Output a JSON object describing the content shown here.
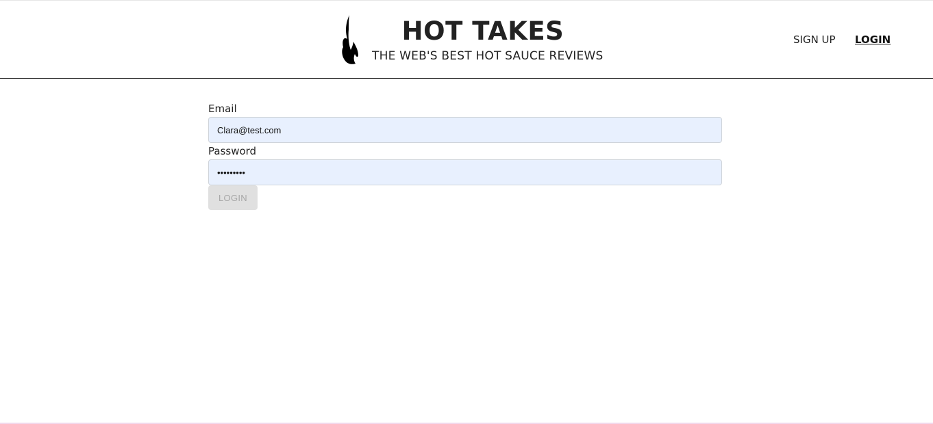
{
  "header": {
    "title": "HOT TAKES",
    "subtitle": "THE WEB'S BEST HOT SAUCE REVIEWS",
    "logo_icon": "flame-icon"
  },
  "nav": {
    "signup_label": "SIGN UP",
    "login_label": "LOGIN",
    "active": "login"
  },
  "form": {
    "email_label": "Email",
    "email_value": "Clara@test.com",
    "password_label": "Password",
    "password_value": "•••••••••",
    "submit_label": "LOGIN",
    "submit_disabled": true
  },
  "colors": {
    "input_background": "#e8f0fe",
    "button_disabled_background": "#e0e0e0",
    "button_disabled_text": "#a6a6a6",
    "header_rule": "#111111"
  }
}
